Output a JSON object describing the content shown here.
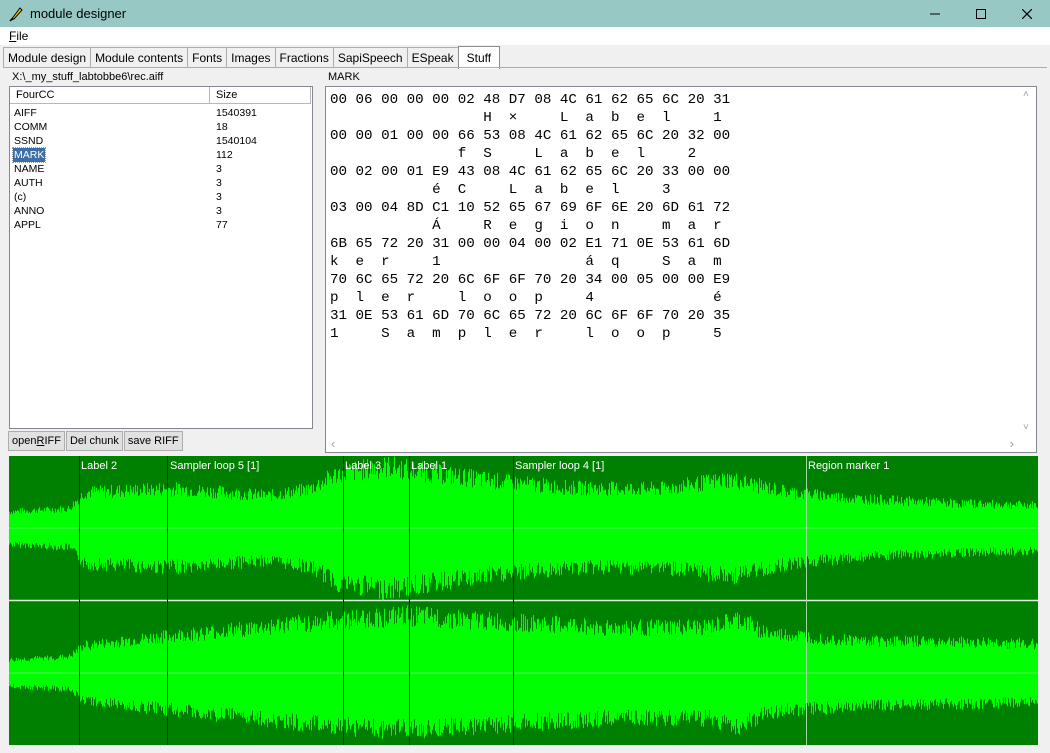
{
  "window": {
    "title": "module designer"
  },
  "menu": {
    "file_accel": "F",
    "file_rest": "ile"
  },
  "tabs": [
    {
      "label": "Module design"
    },
    {
      "label": "Module contents"
    },
    {
      "label": "Fonts"
    },
    {
      "label": "Images"
    },
    {
      "label": "Fractions"
    },
    {
      "label": "SapiSpeech"
    },
    {
      "label": "ESpeak"
    },
    {
      "label": "Stuff",
      "active": true
    }
  ],
  "file_path": "X:\\_my_stuff_labtobbe6\\rec.aiff",
  "chunk_list": {
    "headers": {
      "fourcc": "FourCC",
      "size": "Size"
    },
    "rows": [
      {
        "fourcc": "AIFF",
        "size": "1540391"
      },
      {
        "fourcc": "COMM",
        "size": "18"
      },
      {
        "fourcc": "SSND",
        "size": "1540104"
      },
      {
        "fourcc": "MARK",
        "size": "112",
        "selected": true
      },
      {
        "fourcc": "NAME",
        "size": "3"
      },
      {
        "fourcc": "AUTH",
        "size": "3"
      },
      {
        "fourcc": "(c)",
        "size": "3"
      },
      {
        "fourcc": "ANNO",
        "size": "3"
      },
      {
        "fourcc": "APPL",
        "size": "77"
      }
    ]
  },
  "buttons": {
    "open_riff_a": "open ",
    "open_riff_accel": "R",
    "open_riff_b": "IFF",
    "del_chunk": "Del chunk",
    "save_riff": "save RIFF"
  },
  "chunk_title": "MARK",
  "hex_view": {
    "text": "00 06 00 00 00 02 48 D7 08 4C 61 62 65 6C 20 31\n                  H  ×     L  a  b  e  l     1\n00 00 01 00 00 66 53 08 4C 61 62 65 6C 20 32 00\n               f  S     L  a  b  e  l     2\n00 02 00 01 E9 43 08 4C 61 62 65 6C 20 33 00 00\n            é  C     L  a  b  e  l     3\n03 00 04 8D C1 10 52 65 67 69 6F 6E 20 6D 61 72\n            Á     R  e  g  i  o  n     m  a  r\n6B 65 72 20 31 00 00 04 00 02 E1 71 0E 53 61 6D\nk  e  r     1                 á  q     S  a  m\n70 6C 65 72 20 6C 6F 6F 70 20 34 00 05 00 00 E9\np  l  e  r     l  o  o  p     4              é\n31 0E 53 61 6D 70 6C 65 72 20 6C 6F 6F 70 20 35\n1     S  a  m  p  l  e  r     l  o  o  p     5"
  },
  "markers": [
    {
      "label": "Label 2"
    },
    {
      "label": "Sampler loop 5 [1]"
    },
    {
      "label": "Label 3"
    },
    {
      "label": "Label 1"
    },
    {
      "label": "Sampler loop 4 [1]"
    },
    {
      "label": "Region marker 1"
    }
  ],
  "colors": {
    "wave_background": "#008000",
    "wave_foreground": "#00ff00",
    "marker_line": "#1a1a1a",
    "selection": "#3c6ea9"
  }
}
